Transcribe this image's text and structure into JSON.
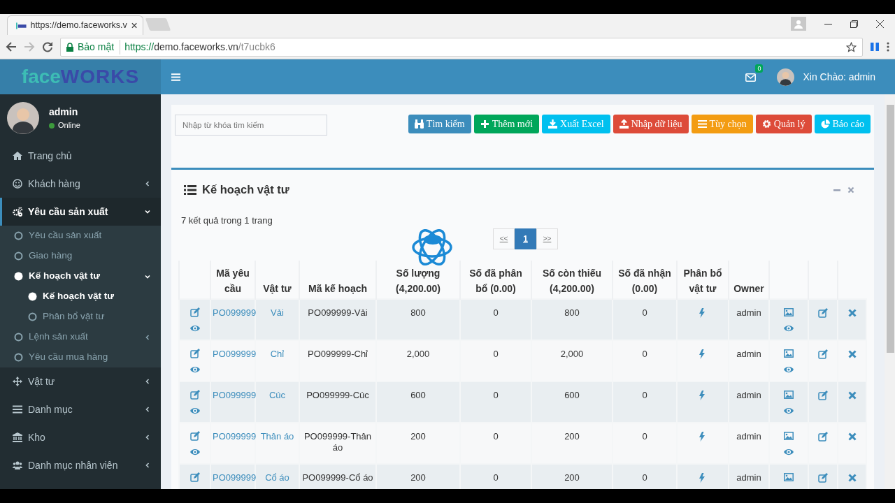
{
  "browser": {
    "tab_title": "https://demo.faceworks.v",
    "security_label": "Bảo mật",
    "url_scheme": "https://",
    "url_host": "demo.faceworks.vn",
    "url_path": "/t7ucbk6"
  },
  "logo": {
    "part_1": "face",
    "part_2": "WORKS"
  },
  "user_panel": {
    "name": "admin",
    "status": "Online"
  },
  "sidebar": {
    "items": [
      {
        "kind": "link",
        "label": "Trang chủ",
        "selected": false
      },
      {
        "kind": "group",
        "label": "Khách hàng",
        "expanded": false,
        "selected": false
      },
      {
        "kind": "group",
        "label": "Yêu cầu sản xuất",
        "expanded": true,
        "selected": true,
        "children": [
          {
            "kind": "link",
            "label": "Yêu cầu sản xuất",
            "selected": false
          },
          {
            "kind": "link",
            "label": "Giao hàng",
            "selected": false
          },
          {
            "kind": "group",
            "label": "Kế hoạch vật tư",
            "expanded": true,
            "selected": true,
            "children": [
              {
                "kind": "link",
                "label": "Kế hoạch vật tư",
                "selected": true
              },
              {
                "kind": "link",
                "label": "Phân bổ vật tư",
                "selected": false
              }
            ]
          },
          {
            "kind": "group",
            "label": "Lệnh sản xuất",
            "expanded": false,
            "selected": false
          },
          {
            "kind": "link",
            "label": "Yêu cầu mua hàng",
            "selected": false
          }
        ]
      },
      {
        "kind": "group",
        "label": "Vật tư",
        "expanded": false,
        "selected": false
      },
      {
        "kind": "group",
        "label": "Danh mục",
        "expanded": false,
        "selected": false
      },
      {
        "kind": "group",
        "label": "Kho",
        "expanded": false,
        "selected": false
      },
      {
        "kind": "group",
        "label": "Danh mục nhân viên",
        "expanded": false,
        "selected": false
      }
    ]
  },
  "header": {
    "mail_count": "0",
    "greeting": "Xin Chào: admin"
  },
  "search": {
    "placeholder": "Nhập từ khóa tìm kiếm"
  },
  "toolbar_buttons": [
    {
      "label": "Tìm kiếm",
      "color": "#3c8dbc"
    },
    {
      "label": "Thêm mới",
      "color": "#00a65a"
    },
    {
      "label": "Xuất Excel",
      "color": "#00c0ef"
    },
    {
      "label": "Nhập dữ liệu",
      "color": "#dd4b39"
    },
    {
      "label": "Tùy chọn",
      "color": "#f39c12"
    },
    {
      "label": "Quản lý",
      "color": "#dd4b39"
    },
    {
      "label": "Báo cáo",
      "color": "#00c0ef"
    }
  ],
  "panel": {
    "title": "Kế hoạch vật tư",
    "result_summary": "7 kết quả trong 1 trang",
    "loading": true,
    "pagination": [
      {
        "label": "<<",
        "selected": false
      },
      {
        "label": "1",
        "selected": true
      },
      {
        "label": ">>",
        "selected": false
      }
    ]
  },
  "table": {
    "columns": [
      "Mã yêu cầu",
      "Vật tư",
      "Mã kế hoạch",
      "Số lượng (4,200.00)",
      "Số đã phân bổ (0.00)",
      "Số còn thiếu (4,200.00)",
      "Số đã nhận (0.00)",
      "Phân bổ vật tư",
      "Owner"
    ],
    "rows": [
      {
        "cells": [
          "PO099999",
          "Vải",
          "PO099999-Vải",
          "800",
          "0",
          "800",
          "0",
          "admin"
        ]
      },
      {
        "cells": [
          "PO099999",
          "Chỉ",
          "PO099999-Chỉ",
          "2,000",
          "0",
          "2,000",
          "0",
          "admin"
        ]
      },
      {
        "cells": [
          "PO099999",
          "Cúc",
          "PO099999-Cúc",
          "600",
          "0",
          "600",
          "0",
          "admin"
        ]
      },
      {
        "cells": [
          "PO099999",
          "Thân áo",
          "PO099999-Thân áo",
          "200",
          "0",
          "200",
          "0",
          "admin"
        ]
      },
      {
        "cells": [
          "PO099999",
          "Cổ áo",
          "PO099999-Cổ áo",
          "200",
          "0",
          "200",
          "0",
          "admin"
        ]
      }
    ]
  }
}
